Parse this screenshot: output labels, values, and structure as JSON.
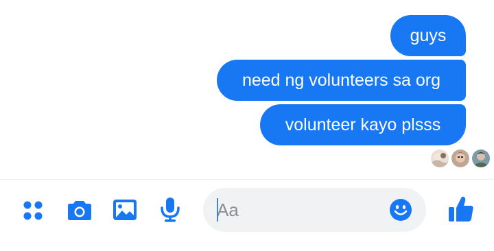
{
  "messages": [
    {
      "text": "guys"
    },
    {
      "text": "need ng volunteers sa org"
    },
    {
      "text": "volunteer kayo plsss"
    }
  ],
  "composer": {
    "placeholder": "Aa"
  },
  "icons": {
    "menu": "dots-grid-icon",
    "camera": "camera-icon",
    "gallery": "image-icon",
    "voice": "microphone-icon",
    "emoji": "smiley-icon",
    "like": "thumbs-up-icon"
  },
  "colors": {
    "accent": "#1877f2",
    "composer_bg": "#f1f2f4",
    "bubble_text": "#ffffff"
  }
}
